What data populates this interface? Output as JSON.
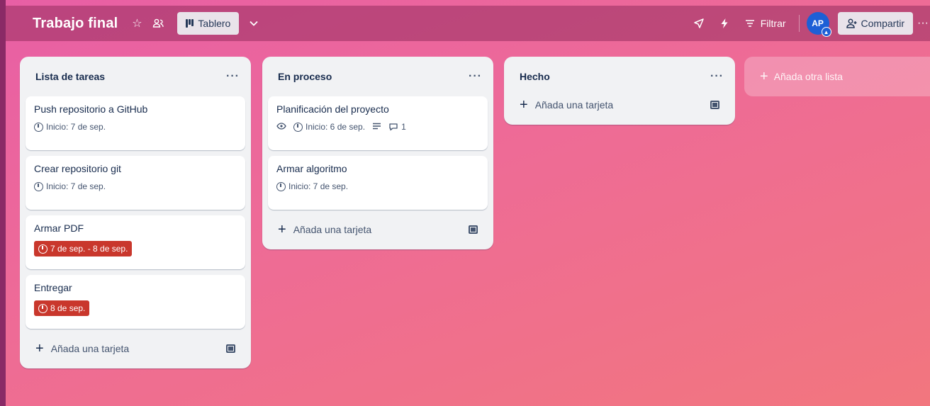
{
  "board": {
    "title": "Trabajo final"
  },
  "header": {
    "view_label": "Tablero",
    "filter_label": "Filtrar",
    "avatar_initials": "AP",
    "share_label": "Compartir"
  },
  "lists": [
    {
      "title": "Lista de tareas",
      "cards": [
        {
          "title": "Push repositorio a GitHub",
          "date": "Inicio: 7 de sep."
        },
        {
          "title": "Crear repositorio git",
          "date": "Inicio: 7 de sep."
        },
        {
          "title": "Armar PDF",
          "date": "7 de sep. - 8 de sep."
        },
        {
          "title": "Entregar",
          "date": "8 de sep."
        }
      ],
      "add_label": "Añada una tarjeta"
    },
    {
      "title": "En proceso",
      "cards": [
        {
          "title": "Planificación del proyecto",
          "date": "Inicio: 6 de sep.",
          "comments": "1"
        },
        {
          "title": "Armar algoritmo",
          "date": "Inicio: 7 de sep."
        }
      ],
      "add_label": "Añada una tarjeta"
    },
    {
      "title": "Hecho",
      "cards": [],
      "add_label": "Añada una tarjeta"
    }
  ],
  "add_list_label": "Añada otra lista",
  "colors": {
    "overdue": "#c9372c",
    "avatar": "#1d5fd6"
  }
}
